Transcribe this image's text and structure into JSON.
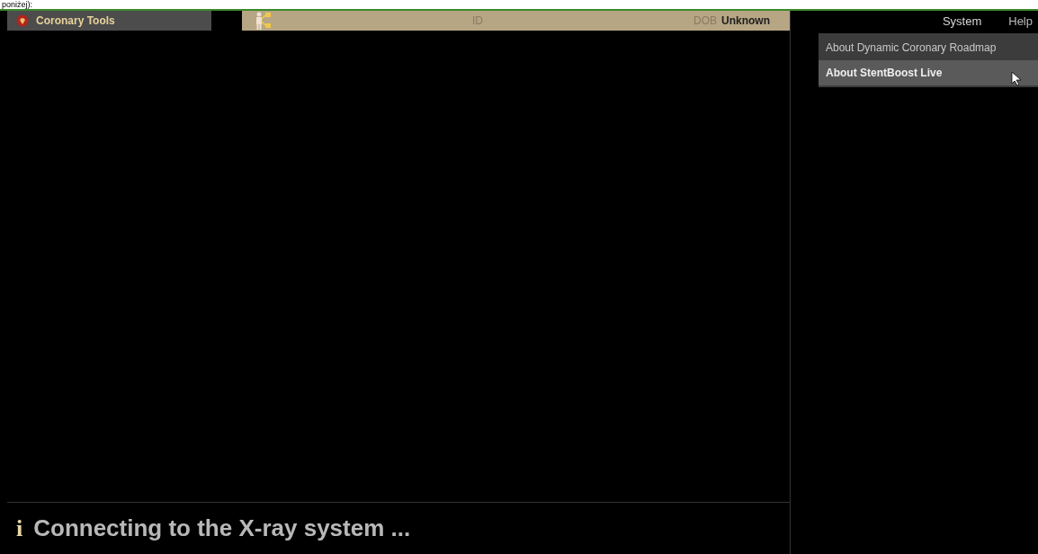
{
  "caption": "poniżej):",
  "app": {
    "title": "Coronary Tools"
  },
  "patient": {
    "id_label": "ID",
    "dob_label": "DOB",
    "dob_value": "Unknown"
  },
  "menubar": [
    {
      "label": "System",
      "selected": true
    },
    {
      "label": "Help",
      "selected": false
    }
  ],
  "dropdown": [
    {
      "label": "About Dynamic Coronary Roadmap",
      "selected": false
    },
    {
      "label": "About StentBoost Live",
      "selected": true
    }
  ],
  "status": {
    "message": "Connecting to the X-ray system ...",
    "info_icon": "i"
  }
}
